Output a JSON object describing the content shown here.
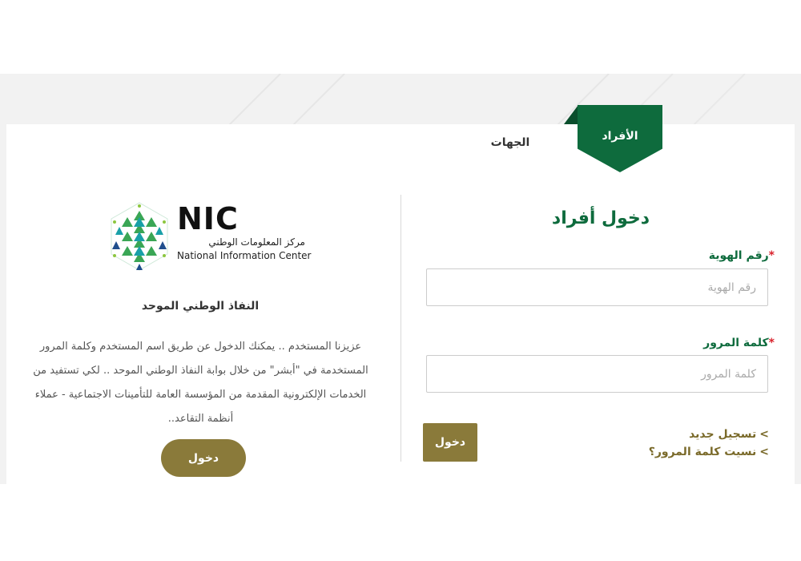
{
  "tabs": {
    "individuals": "الأفراد",
    "entities": "الجهات"
  },
  "login_form": {
    "title": "دخول أفراد",
    "id_label": "رقم الهوية",
    "id_placeholder": "رقم الهوية",
    "password_label": "كلمة المرور",
    "password_placeholder": "كلمة المرور",
    "required_mark": "*",
    "submit_label": "دخول",
    "register_link": "تسجيل جديد",
    "forgot_link": "نسيت كلمة المرور؟",
    "link_chevron": ">"
  },
  "nic_panel": {
    "logo_abbrev": "NIC",
    "logo_arabic": "مركز المعلومات الوطني",
    "logo_english": "National Information Center",
    "title": "النفاذ الوطني الموحد",
    "description": "عزيزنا المستخدم .. يمكنك الدخول عن طريق اسم المستخدم وكلمة المرور المستخدمة في \"أبشر\" من خلال بوابة النفاذ الوطني الموحد .. لكي تستفيد من الخدمات الإلكترونية المقدمة من المؤسسة العامة للتأمينات الاجتماعية - عملاء أنظمة التقاعد..",
    "button_label": "دخول"
  },
  "colors": {
    "brand_green": "#0e6b3d",
    "gold": "#8a7a3a",
    "required_red": "#d9232d"
  }
}
